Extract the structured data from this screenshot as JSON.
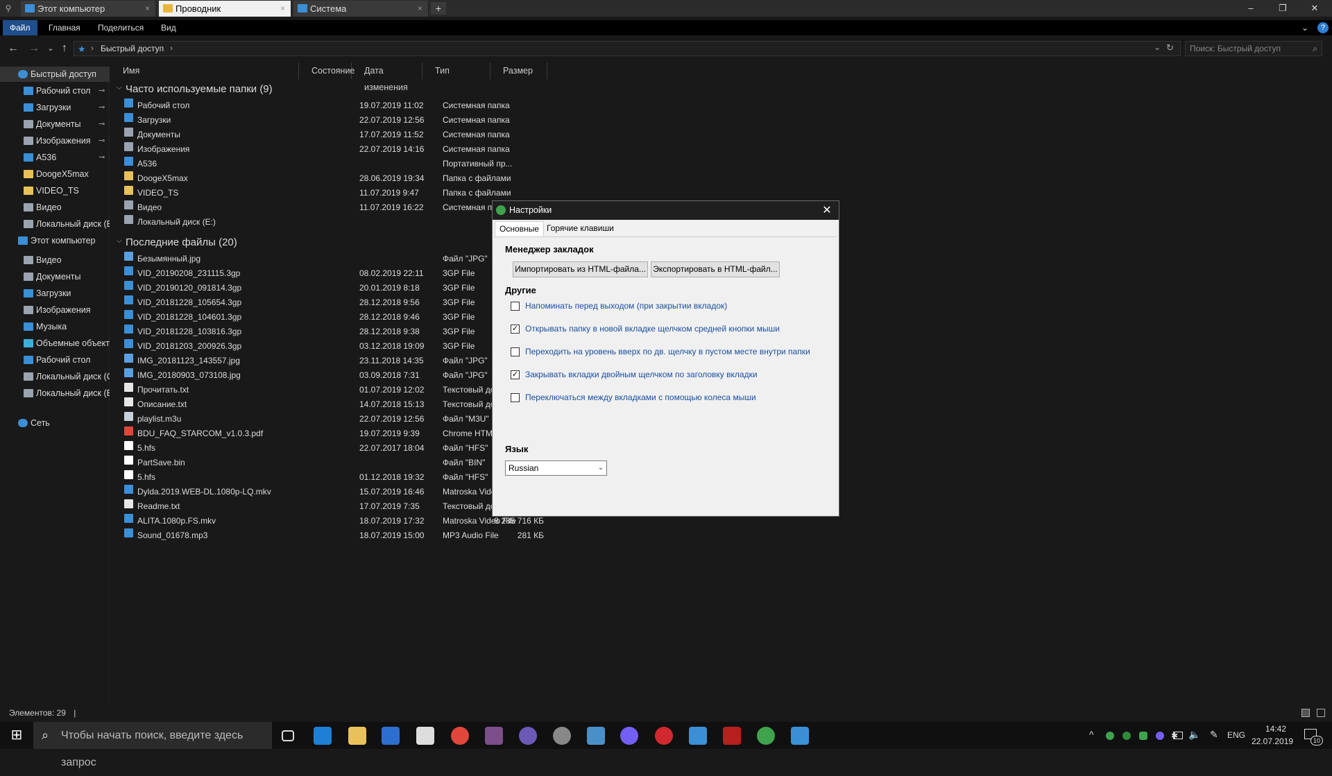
{
  "tabs": [
    {
      "label": "Этот компьютер",
      "active": false
    },
    {
      "label": "Проводник",
      "active": true
    },
    {
      "label": "Система",
      "active": false
    }
  ],
  "tab_close": "×",
  "new_tab": "+",
  "window_controls": {
    "minimize": "–",
    "restore": "❐",
    "close": "✕"
  },
  "ribbon": {
    "file": "Файл",
    "home": "Главная",
    "share": "Поделиться",
    "view": "Вид",
    "expand": "⌄",
    "help": "?"
  },
  "address": {
    "path": "Быстрый доступ",
    "sep": "›",
    "search_placeholder": "Поиск: Быстрый доступ",
    "back": "←",
    "forward": "→",
    "recent": "⌄",
    "up": "↑",
    "refresh": "↻",
    "dropdown": "⌄"
  },
  "sidebar": [
    {
      "label": "Быстрый доступ",
      "level": 0,
      "icon": "star-icon",
      "color": "#3b8fd6",
      "selected": true
    },
    {
      "label": "Рабочий стол",
      "level": 1,
      "icon": "desktop-icon",
      "color": "#3b8fd6",
      "pinned": true
    },
    {
      "label": "Загрузки",
      "level": 1,
      "icon": "download-icon",
      "color": "#3b8fd6",
      "pinned": true
    },
    {
      "label": "Документы",
      "level": 1,
      "icon": "document-icon",
      "color": "#9aa4b0",
      "pinned": true
    },
    {
      "label": "Изображения",
      "level": 1,
      "icon": "image-icon",
      "color": "#9aa4b0",
      "pinned": true
    },
    {
      "label": "A536",
      "level": 1,
      "icon": "phone-icon",
      "color": "#3b8fd6",
      "pinned": true
    },
    {
      "label": "DoogeX5max",
      "level": 1,
      "icon": "folder-icon",
      "color": "#e8c15a"
    },
    {
      "label": "VIDEO_TS",
      "level": 1,
      "icon": "folder-icon",
      "color": "#e8c15a"
    },
    {
      "label": "Видео",
      "level": 1,
      "icon": "video-icon",
      "color": "#9aa4b0"
    },
    {
      "label": "Локальный диск (E",
      "level": 1,
      "icon": "drive-icon",
      "color": "#9aa4b0"
    },
    {
      "label": "Этот компьютер",
      "level": 0,
      "icon": "computer-icon",
      "color": "#3b8fd6"
    },
    {
      "label": "Видео",
      "level": 1,
      "icon": "video-icon",
      "color": "#9aa4b0"
    },
    {
      "label": "Документы",
      "level": 1,
      "icon": "document-icon",
      "color": "#9aa4b0"
    },
    {
      "label": "Загрузки",
      "level": 1,
      "icon": "download-icon",
      "color": "#3b8fd6"
    },
    {
      "label": "Изображения",
      "level": 1,
      "icon": "image-icon",
      "color": "#9aa4b0"
    },
    {
      "label": "Музыка",
      "level": 1,
      "icon": "music-icon",
      "color": "#3b8fd6"
    },
    {
      "label": "Объемные объекть",
      "level": 1,
      "icon": "cube-icon",
      "color": "#3bb0d6"
    },
    {
      "label": "Рабочий стол",
      "level": 1,
      "icon": "desktop-icon",
      "color": "#3b8fd6"
    },
    {
      "label": "Локальный диск (C",
      "level": 1,
      "icon": "drive-icon",
      "color": "#9aa4b0"
    },
    {
      "label": "Локальный диск (E",
      "level": 1,
      "icon": "drive-icon",
      "color": "#9aa4b0"
    },
    {
      "label": "Сеть",
      "level": 0,
      "icon": "network-icon",
      "color": "#3b8fd6"
    }
  ],
  "pin_glyph": "📌",
  "columns": [
    "Имя",
    "Состояние",
    "Дата изменения",
    "Тип",
    "Размер"
  ],
  "groups": [
    {
      "title": "Часто используемые папки (9)",
      "rows": [
        {
          "name": "Рабочий стол",
          "date": "19.07.2019 11:02",
          "type": "Системная папка",
          "size": "",
          "icon": "desktop-icon",
          "color": "#3b8fd6"
        },
        {
          "name": "Загрузки",
          "date": "22.07.2019 12:56",
          "type": "Системная папка",
          "size": "",
          "icon": "download-icon",
          "color": "#3b8fd6"
        },
        {
          "name": "Документы",
          "date": "17.07.2019 11:52",
          "type": "Системная папка",
          "size": "",
          "icon": "document-icon",
          "color": "#9aa4b0"
        },
        {
          "name": "Изображения",
          "date": "22.07.2019 14:16",
          "type": "Системная папка",
          "size": "",
          "icon": "image-icon",
          "color": "#9aa4b0"
        },
        {
          "name": "A536",
          "date": "",
          "type": "Портативный пр...",
          "size": "",
          "icon": "phone-icon",
          "color": "#3b8fd6"
        },
        {
          "name": "DoogeX5max",
          "date": "28.06.2019 19:34",
          "type": "Папка с файлами",
          "size": "",
          "icon": "folder-icon",
          "color": "#e8c15a"
        },
        {
          "name": "VIDEO_TS",
          "date": "11.07.2019 9:47",
          "type": "Папка с файлами",
          "size": "",
          "icon": "folder-icon",
          "color": "#e8c15a"
        },
        {
          "name": "Видео",
          "date": "11.07.2019 16:22",
          "type": "Системная п",
          "size": "",
          "icon": "video-icon",
          "color": "#9aa4b0"
        },
        {
          "name": "Локальный диск (E:)",
          "date": "",
          "type": "",
          "size": "",
          "icon": "drive-icon",
          "color": "#9aa4b0"
        }
      ]
    },
    {
      "title": "Последние файлы (20)",
      "rows": [
        {
          "name": "Безымянный.jpg",
          "date": "",
          "type": "Файл \"JPG\"",
          "size": "",
          "icon": "image-file-icon",
          "color": "#5aa0e0"
        },
        {
          "name": "VID_20190208_231115.3gp",
          "date": "08.02.2019 22:11",
          "type": "3GP File",
          "size": "",
          "icon": "video-file-icon",
          "color": "#3b8fd6"
        },
        {
          "name": "VID_20190120_091814.3gp",
          "date": "20.01.2019 8:18",
          "type": "3GP File",
          "size": "",
          "icon": "video-file-icon",
          "color": "#3b8fd6"
        },
        {
          "name": "VID_20181228_105654.3gp",
          "date": "28.12.2018 9:56",
          "type": "3GP File",
          "size": "",
          "icon": "video-file-icon",
          "color": "#3b8fd6"
        },
        {
          "name": "VID_20181228_104601.3gp",
          "date": "28.12.2018 9:46",
          "type": "3GP File",
          "size": "",
          "icon": "video-file-icon",
          "color": "#3b8fd6"
        },
        {
          "name": "VID_20181228_103816.3gp",
          "date": "28.12.2018 9:38",
          "type": "3GP File",
          "size": "",
          "icon": "video-file-icon",
          "color": "#3b8fd6"
        },
        {
          "name": "VID_20181203_200926.3gp",
          "date": "03.12.2018 19:09",
          "type": "3GP File",
          "size": "",
          "icon": "video-file-icon",
          "color": "#3b8fd6"
        },
        {
          "name": "IMG_20181123_143557.jpg",
          "date": "23.11.2018 14:35",
          "type": "Файл \"JPG\"",
          "size": "",
          "icon": "image-file-icon",
          "color": "#5aa0e0"
        },
        {
          "name": "IMG_20180903_073108.jpg",
          "date": "03.09.2018 7:31",
          "type": "Файл \"JPG\"",
          "size": "",
          "icon": "image-file-icon",
          "color": "#5aa0e0"
        },
        {
          "name": "Прочитать.txt",
          "date": "01.07.2019 12:02",
          "type": "Текстовый до",
          "size": "",
          "icon": "text-file-icon",
          "color": "#e6e6e6"
        },
        {
          "name": "Описание.txt",
          "date": "14.07.2018 15:13",
          "type": "Текстовый до",
          "size": "",
          "icon": "text-file-icon",
          "color": "#e6e6e6"
        },
        {
          "name": "playlist.m3u",
          "date": "22.07.2019 12:56",
          "type": "Файл \"M3U\"",
          "size": "",
          "icon": "playlist-file-icon",
          "color": "#c8d0da"
        },
        {
          "name": "BDU_FAQ_STARCOM_v1.0.3.pdf",
          "date": "19.07.2019 9:39",
          "type": "Chrome HTM",
          "size": "",
          "icon": "chrome-icon",
          "color": "#e0473a"
        },
        {
          "name": "5.hfs",
          "date": "22.07.2017 18:04",
          "type": "Файл \"HFS\"",
          "size": "",
          "icon": "file-icon",
          "color": "#ffffff"
        },
        {
          "name": "PartSave.bin",
          "date": "",
          "type": "Файл \"BIN\"",
          "size": "",
          "icon": "file-icon",
          "color": "#ffffff"
        },
        {
          "name": "5.hfs",
          "date": "01.12.2018 19:32",
          "type": "Файл \"HFS\"",
          "size": "",
          "icon": "file-icon",
          "color": "#ffffff"
        },
        {
          "name": "Dylda.2019.WEB-DL.1080p-LQ.mkv",
          "date": "15.07.2019 16:46",
          "type": "Matroska Vide",
          "size": "",
          "icon": "video-file-icon",
          "color": "#3b8fd6"
        },
        {
          "name": "Readme.txt",
          "date": "17.07.2019 7:35",
          "type": "Текстовый до",
          "size": "",
          "icon": "text-file-icon",
          "color": "#e6e6e6"
        },
        {
          "name": "ALITA.1080p.FS.mkv",
          "date": "18.07.2019 17:32",
          "type": "Matroska Video File",
          "size": "8 285 716 КБ",
          "icon": "video-file-icon",
          "color": "#3b8fd6"
        },
        {
          "name": "Sound_01678.mp3",
          "date": "18.07.2019 15:00",
          "type": "MP3 Audio File",
          "size": "281 КБ",
          "icon": "audio-file-icon",
          "color": "#3b8fd6"
        }
      ]
    }
  ],
  "status": {
    "items": "Элементов: 29",
    "sep": "|"
  },
  "dialog": {
    "title": "Настройки",
    "close": "✕",
    "tabs": [
      "Основные",
      "Горячие клавиши"
    ],
    "bookmarks_header": "Менеджер закладок",
    "import_button": "Импортировать из HTML-файла...",
    "export_button": "Экспортировать в HTML-файл...",
    "other_header": "Другие",
    "options": [
      {
        "label": "Напоминать перед выходом (при закрытии вкладок)",
        "checked": false
      },
      {
        "label": "Открывать папку в новой вкладке щелчком средней кнопки мыши",
        "checked": true
      },
      {
        "label": "Переходить на уровень вверх по дв. щелчку в пустом месте внутри папки",
        "checked": false
      },
      {
        "label": "Закрывать вкладки двойным щелчком по заголовку вкладки",
        "checked": true
      },
      {
        "label": "Переключаться между вкладками с помощью колеса мыши",
        "checked": false
      }
    ],
    "check_glyph": "✓",
    "language_header": "Язык",
    "language_value": "Russian",
    "language_arrow": "⌄"
  },
  "taskbar": {
    "search_placeholder": "Чтобы начать поиск, введите здесь запрос",
    "start_glyph": "⊞",
    "search_glyph": "⌕",
    "apps": [
      {
        "name": "task-view-icon",
        "color": "#303030"
      },
      {
        "name": "edge-icon",
        "color": "#1e7fd6"
      },
      {
        "name": "file-explorer-icon",
        "color": "#e8c15a"
      },
      {
        "name": "store-icon",
        "color": "#2d6fd0"
      },
      {
        "name": "mail-icon",
        "color": "#dddddd"
      },
      {
        "name": "chrome-icon",
        "color": "#e0473a"
      },
      {
        "name": "photo-app-icon",
        "color": "#7a4f8a"
      },
      {
        "name": "eclipse-icon",
        "color": "#6a5ab5"
      },
      {
        "name": "media-player-icon",
        "color": "#888888"
      },
      {
        "name": "notepad-icon",
        "color": "#4a90c8"
      },
      {
        "name": "viber-icon",
        "color": "#7360f2"
      },
      {
        "name": "opera-icon",
        "color": "#d0292f"
      },
      {
        "name": "shield-app-icon",
        "color": "#3b8fd6"
      },
      {
        "name": "red-app-icon",
        "color": "#b81f1f"
      },
      {
        "name": "clover-icon",
        "color": "#3fa34d"
      },
      {
        "name": "settings-app-icon",
        "color": "#3b8fd6"
      }
    ],
    "tray": {
      "chevron": "^",
      "lang": "ENG",
      "time": "14:42",
      "date": "22.07.2019",
      "notifications": "10"
    }
  }
}
